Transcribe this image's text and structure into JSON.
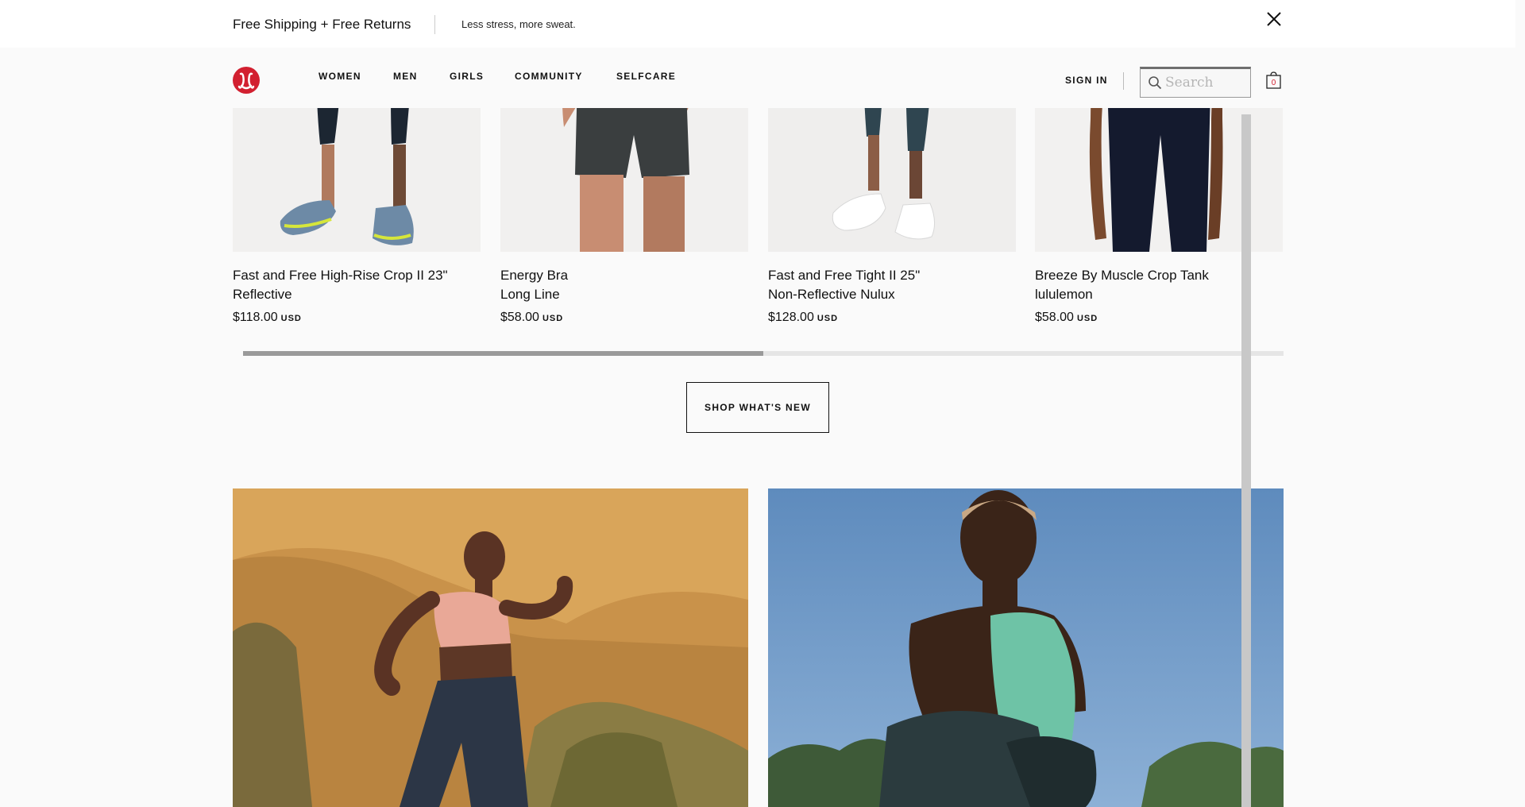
{
  "promo": {
    "main": "Free Shipping + Free Returns",
    "sub": "Less stress, more sweat."
  },
  "nav": {
    "items": [
      "WOMEN",
      "MEN",
      "GIRLS",
      "COMMUNITY",
      "SELFCARE"
    ],
    "sign_in": "SIGN IN",
    "search_placeholder": "Search",
    "bag_count": "0"
  },
  "products": [
    {
      "name": "Fast and Free High-Rise Crop II 23\" Reflective",
      "price": "$118.00",
      "currency": "USD"
    },
    {
      "name": "Energy Bra Long Line",
      "price": "$58.00",
      "currency": "USD"
    },
    {
      "name": "Fast and Free Tight II 25\" Non-Reflective Nulux",
      "price": "$128.00",
      "currency": "USD"
    },
    {
      "name": "Breeze By Muscle Crop Tank lululemon",
      "price": "$58.00",
      "currency": "USD"
    }
  ],
  "carousel": {
    "scroll_position": 0.5
  },
  "shop_button": "SHOP WHAT'S NEW",
  "colors": {
    "brand_red": "#d22030",
    "background": "#fafafa",
    "hero_left_bg": "#c9924a",
    "hero_right_sky": "#6f97c4"
  }
}
